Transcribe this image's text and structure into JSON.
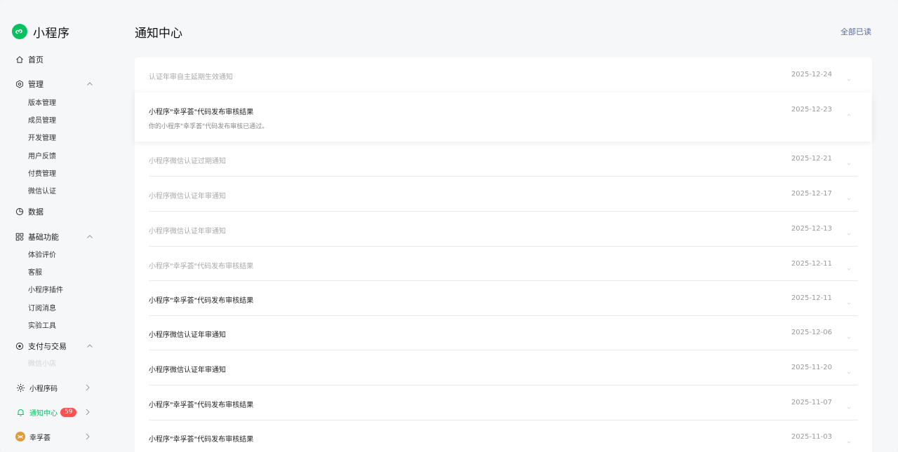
{
  "brand": {
    "name": "小程序"
  },
  "sidebar": {
    "home": "首页",
    "manage": {
      "label": "管理",
      "items": [
        "版本管理",
        "成员管理",
        "开发管理",
        "用户反馈",
        "付费管理",
        "微信认证"
      ]
    },
    "data": "数据",
    "basic": {
      "label": "基础功能",
      "items": [
        "体验评价",
        "客服",
        "小程序插件",
        "订阅消息",
        "实验工具"
      ]
    },
    "pay": {
      "label": "支付与交易",
      "items": [
        "微信小店"
      ]
    },
    "bottom": {
      "qrcode": "小程序码",
      "notice": "通知中心",
      "notice_count": "59",
      "account": "幸孚荟"
    }
  },
  "header": {
    "title": "通知中心",
    "mark_all": "全部已读"
  },
  "notifications": [
    {
      "title": "认证年审自主延期生效通知",
      "date": "2025-12-24"
    },
    {
      "title": "小程序\"幸孚荟\"代码发布审核结果",
      "date": "2025-12-23",
      "detail": "你的小程序\"幸孚荟\"代码发布审核已通过。"
    },
    {
      "title": "小程序微信认证过期通知",
      "date": "2025-12-21"
    },
    {
      "title": "小程序微信认证年审通知",
      "date": "2025-12-17"
    },
    {
      "title": "小程序微信认证年审通知",
      "date": "2025-12-13"
    },
    {
      "title": "小程序\"幸孚荟\"代码发布审核结果",
      "date": "2025-12-11"
    },
    {
      "title": "小程序\"幸孚荟\"代码发布审核结果",
      "date": "2025-12-11"
    },
    {
      "title": "小程序微信认证年审通知",
      "date": "2025-12-06"
    },
    {
      "title": "小程序微信认证年审通知",
      "date": "2025-11-20"
    },
    {
      "title": "小程序\"幸孚荟\"代码发布审核结果",
      "date": "2025-11-07"
    },
    {
      "title": "小程序\"幸孚荟\"代码发布审核结果",
      "date": "2025-11-03"
    }
  ],
  "colors": {
    "accent": "#07c160",
    "link": "#576b95",
    "badge": "#fa5151"
  }
}
